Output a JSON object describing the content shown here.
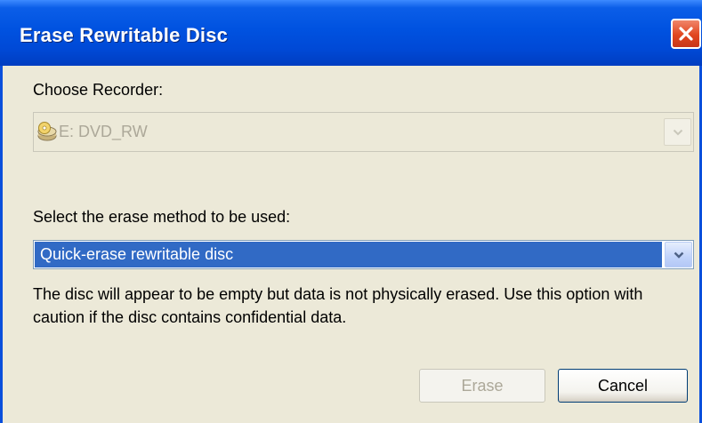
{
  "window": {
    "title": "Erase Rewritable Disc",
    "close_icon": "close-icon"
  },
  "recorder": {
    "label": "Choose Recorder:",
    "selected": "E: DVD_RW",
    "icon": "optical-drive-icon",
    "enabled": false
  },
  "method": {
    "label": "Select the erase method to be used:",
    "selected": "Quick-erase rewritable disc",
    "description": "The disc will appear to be empty but data is not physically erased. Use this option with caution if the disc contains confidential data."
  },
  "buttons": {
    "erase_label": "Erase",
    "erase_enabled": false,
    "cancel_label": "Cancel"
  },
  "colors": {
    "titlebar": "#0052e0",
    "selection": "#316ac5",
    "dialog_bg": "#ece9d8",
    "close": "#e1461f"
  }
}
